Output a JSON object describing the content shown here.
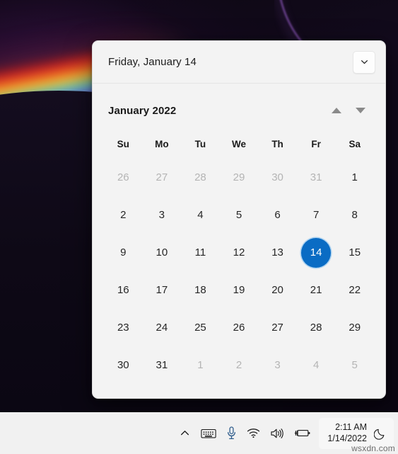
{
  "desktop": {
    "wallpaper_name": "windows-11-dark-bloom-wallpaper"
  },
  "flyout": {
    "header": {
      "date_label": "Friday, January 14",
      "expand_icon": "chevron-down-icon"
    },
    "month_label": "January 2022",
    "prev_icon": "triangle-up-icon",
    "next_icon": "triangle-down-icon",
    "day_headers": [
      "Su",
      "Mo",
      "Tu",
      "We",
      "Th",
      "Fr",
      "Sa"
    ],
    "selected_day": 14,
    "accent_color": "#0a6cc4",
    "surface_color": "#f3f3f3",
    "weeks": [
      [
        {
          "n": "26",
          "muted": true
        },
        {
          "n": "27",
          "muted": true
        },
        {
          "n": "28",
          "muted": true
        },
        {
          "n": "29",
          "muted": true
        },
        {
          "n": "30",
          "muted": true
        },
        {
          "n": "31",
          "muted": true
        },
        {
          "n": "1",
          "muted": false
        }
      ],
      [
        {
          "n": "2",
          "muted": false
        },
        {
          "n": "3",
          "muted": false
        },
        {
          "n": "4",
          "muted": false
        },
        {
          "n": "5",
          "muted": false
        },
        {
          "n": "6",
          "muted": false
        },
        {
          "n": "7",
          "muted": false
        },
        {
          "n": "8",
          "muted": false
        }
      ],
      [
        {
          "n": "9",
          "muted": false
        },
        {
          "n": "10",
          "muted": false
        },
        {
          "n": "11",
          "muted": false
        },
        {
          "n": "12",
          "muted": false
        },
        {
          "n": "13",
          "muted": false
        },
        {
          "n": "14",
          "muted": false,
          "selected": true
        },
        {
          "n": "15",
          "muted": false
        }
      ],
      [
        {
          "n": "16",
          "muted": false
        },
        {
          "n": "17",
          "muted": false
        },
        {
          "n": "18",
          "muted": false
        },
        {
          "n": "19",
          "muted": false
        },
        {
          "n": "20",
          "muted": false
        },
        {
          "n": "21",
          "muted": false
        },
        {
          "n": "22",
          "muted": false
        }
      ],
      [
        {
          "n": "23",
          "muted": false
        },
        {
          "n": "24",
          "muted": false
        },
        {
          "n": "25",
          "muted": false
        },
        {
          "n": "26",
          "muted": false
        },
        {
          "n": "27",
          "muted": false
        },
        {
          "n": "28",
          "muted": false
        },
        {
          "n": "29",
          "muted": false
        }
      ],
      [
        {
          "n": "30",
          "muted": false
        },
        {
          "n": "31",
          "muted": false
        },
        {
          "n": "1",
          "muted": true
        },
        {
          "n": "2",
          "muted": true
        },
        {
          "n": "3",
          "muted": true
        },
        {
          "n": "4",
          "muted": true
        },
        {
          "n": "5",
          "muted": true
        }
      ]
    ]
  },
  "taskbar": {
    "tray_icons": [
      {
        "name": "chevron-up-icon",
        "label": "Show hidden icons"
      },
      {
        "name": "keyboard-icon",
        "label": "Touch keyboard"
      },
      {
        "name": "microphone-icon",
        "label": "Microphone"
      },
      {
        "name": "wifi-icon",
        "label": "Network"
      },
      {
        "name": "volume-icon",
        "label": "Volume"
      },
      {
        "name": "battery-charging-icon",
        "label": "Battery charging"
      }
    ],
    "clock": {
      "time": "2:11 AM",
      "date": "1/14/2022"
    },
    "notification_icon": "moon-icon"
  },
  "watermark": "wsxdn.com"
}
